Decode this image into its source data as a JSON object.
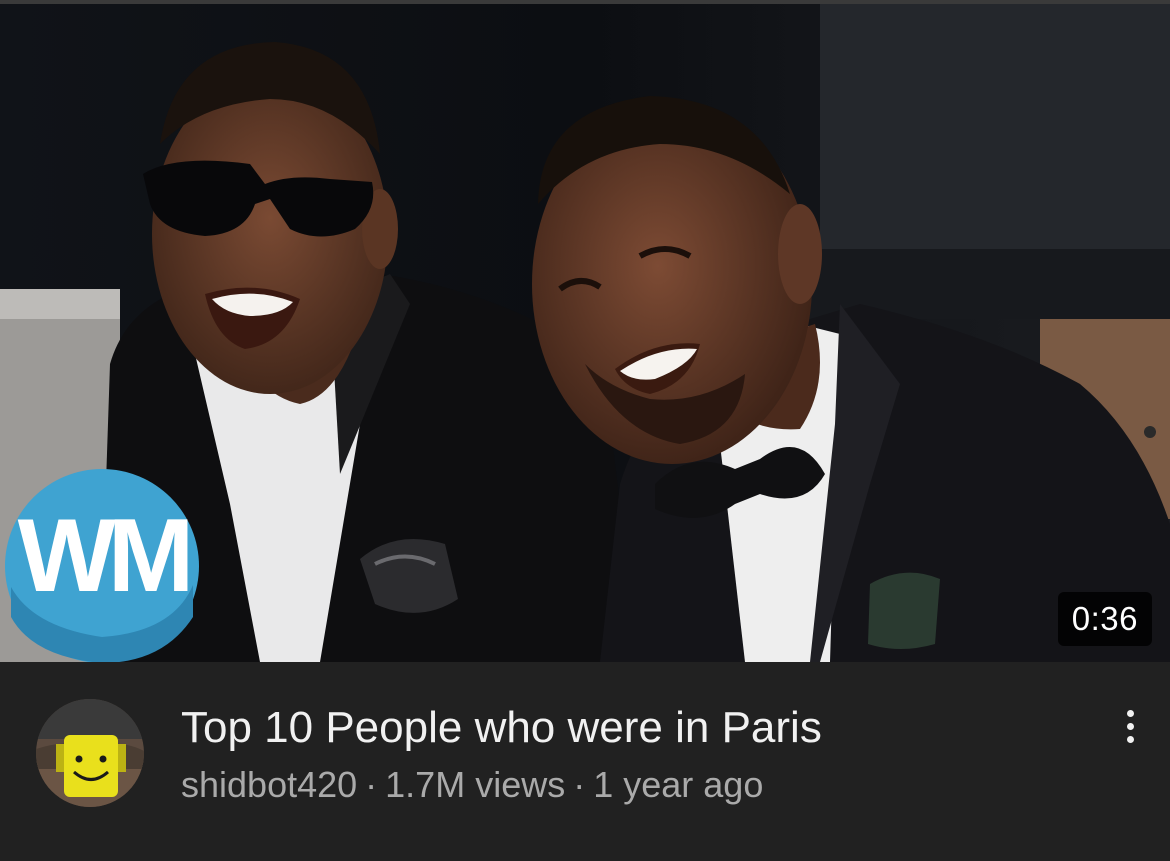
{
  "video": {
    "title": "Top 10 People who were in Paris",
    "duration": "0:36",
    "channel": "shidbot420",
    "separator": "·",
    "views": "1.7M views",
    "age": "1 year ago",
    "thumbnail_badge_text": "WM"
  },
  "icons": {
    "more": "more-vert-icon",
    "avatar": "channel-avatar"
  },
  "colors": {
    "background": "#212121",
    "title": "#f1f1f1",
    "meta": "#aaaaaa",
    "badge_blue": "#3fa3d1"
  }
}
